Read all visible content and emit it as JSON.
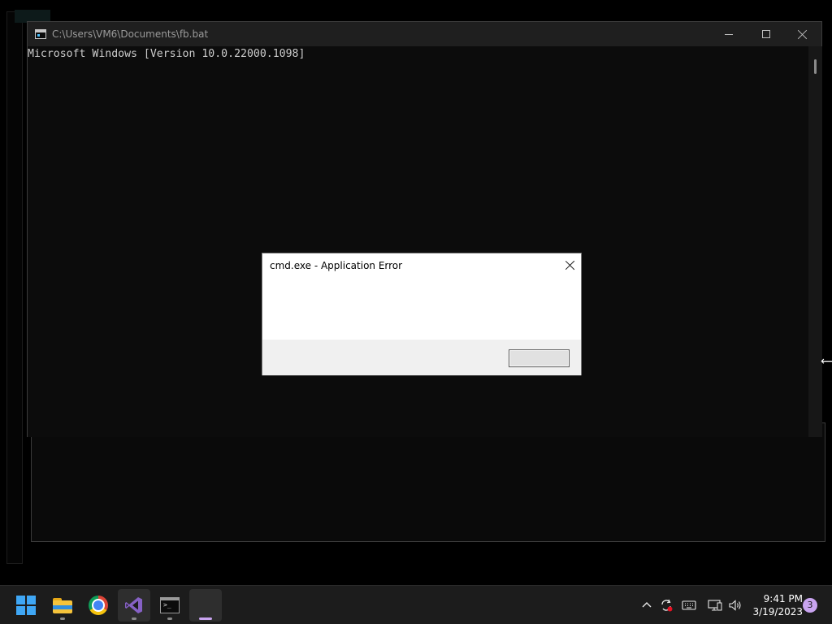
{
  "console": {
    "title": "C:\\Users\\VM6\\Documents\\fb.bat",
    "lines": [
      "Microsoft Windows [Version 10.0.22000.1098]"
    ]
  },
  "dialog": {
    "title": "cmd.exe - Application Error",
    "button_label": ""
  },
  "taskbar": {
    "apps": [
      {
        "name": "start",
        "icon": "windows-start-icon"
      },
      {
        "name": "file-explorer",
        "icon": "folder-icon"
      },
      {
        "name": "chrome",
        "icon": "chrome-icon"
      },
      {
        "name": "visual-studio",
        "icon": "visual-studio-icon"
      },
      {
        "name": "command-prompt",
        "icon": "cmd-icon"
      },
      {
        "name": "blank-app",
        "icon": "blank-icon"
      }
    ],
    "tray": {
      "time": "9:41 PM",
      "date": "3/19/2023",
      "notification_count": "3"
    }
  },
  "colors": {
    "console_bg": "#0c0c0c",
    "console_text": "#cccccc",
    "accent": "#c9a4f0",
    "start_blue": "#3fa7f5"
  }
}
